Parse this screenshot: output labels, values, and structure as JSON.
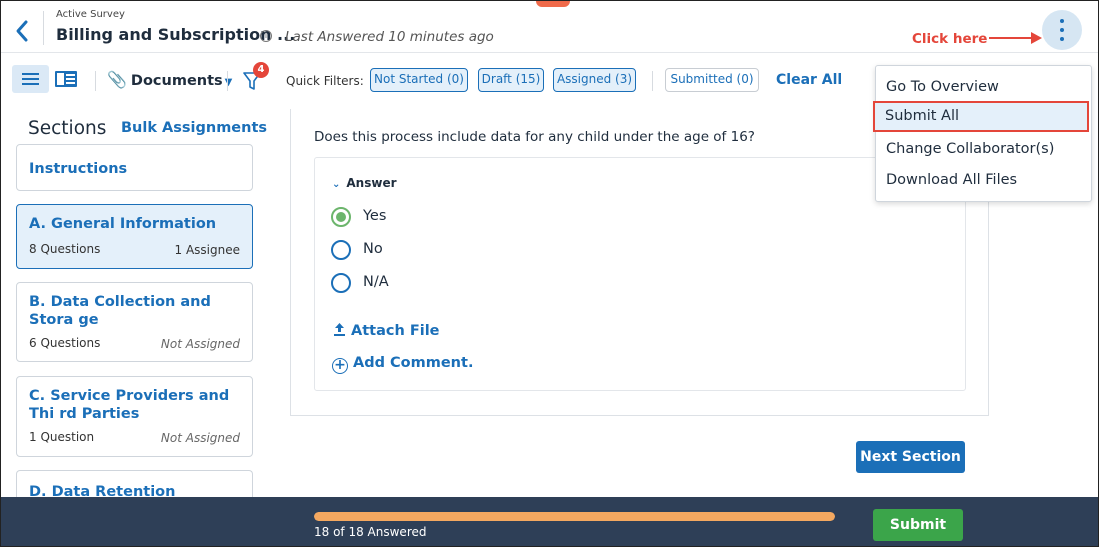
{
  "header": {
    "active_label": "Active Survey",
    "title": "Billing and Subscription ...",
    "info_glyph": "i",
    "last_answered": "Last Answered 10 minutes ago",
    "annotation": "Click here"
  },
  "toolbar": {
    "documents_label": "Documents",
    "filter_badge": "4",
    "quick_filters_label": "Quick Filters:",
    "chips": [
      "Not Started (0)",
      "Draft (15)",
      "Assigned (3)"
    ],
    "submitted_chip": "Submitted (0)",
    "clear_all": "Clear All"
  },
  "sidebar": {
    "title": "Sections",
    "bulk_link": "Bulk Assignments",
    "sections": [
      {
        "name": "Instructions"
      },
      {
        "name": "A. General Information",
        "questions": "8 Questions",
        "assignee": "1 Assignee"
      },
      {
        "name": "B. Data Collection and Stora ge",
        "questions": "6 Questions",
        "assignee": "Not Assigned"
      },
      {
        "name": "C. Service Providers and Thi rd Parties",
        "questions": "1 Question",
        "assignee": "Not Assigned"
      },
      {
        "name": "D. Data Retention"
      }
    ]
  },
  "main": {
    "question": "Does this process include data for any child under the age of 16?",
    "answer_toggle": "Answer",
    "options": [
      "Yes",
      "No",
      "N/A"
    ],
    "selected_option": "Yes",
    "attach_file": "Attach File",
    "add_comment": "Add Comment.",
    "next_section": "Next Section"
  },
  "menu": {
    "items": [
      "Go To Overview",
      "Submit All",
      "Change Collaborator(s)",
      "Download All Files"
    ],
    "highlighted": "Submit All"
  },
  "footer": {
    "progress_fraction": 1.0,
    "progress_text": "18 of 18 Answered",
    "submit": "Submit"
  },
  "colors": {
    "accent": "#1b6fb8",
    "annotation_red": "#e4463a",
    "progress": "#f4a860",
    "submit_green": "#3ba54a",
    "footer_bg": "#2e3f57"
  }
}
